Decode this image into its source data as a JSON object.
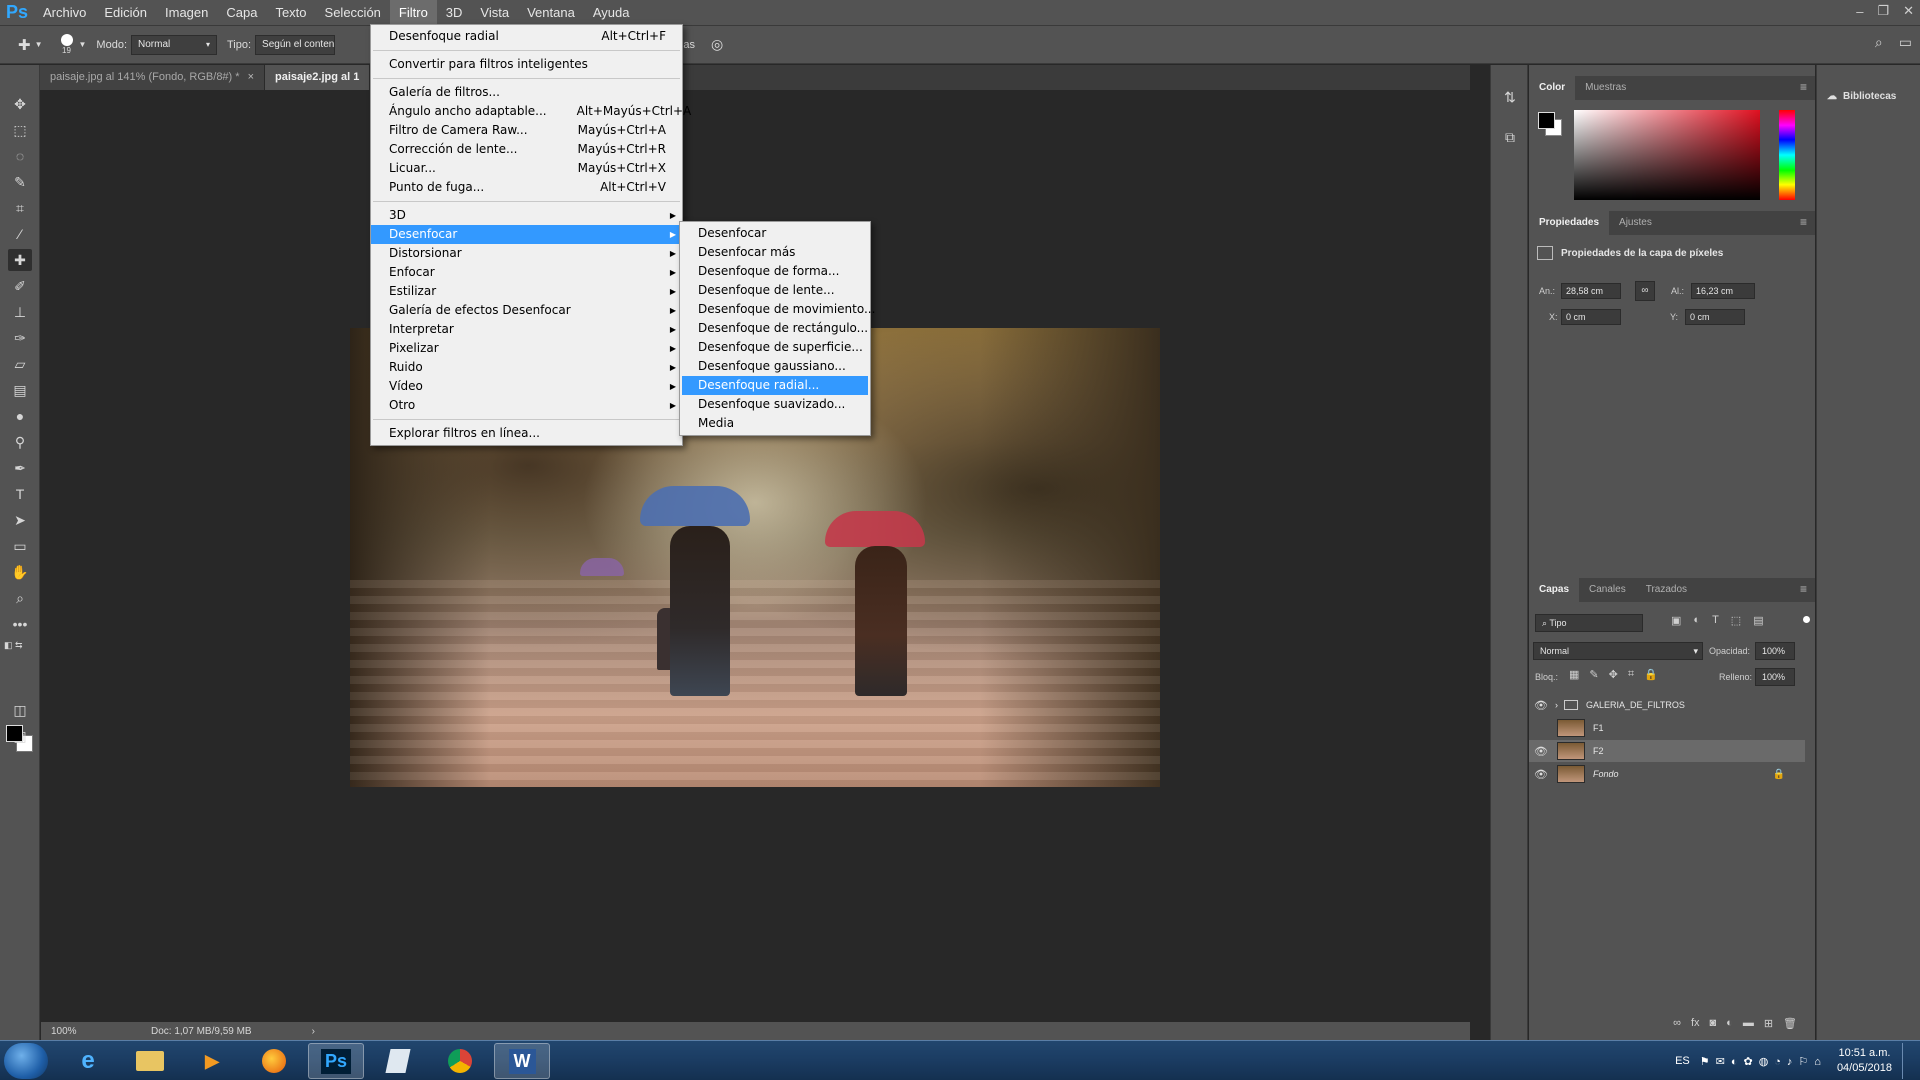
{
  "app": {
    "logo": "Ps"
  },
  "menubar": {
    "items": [
      "Archivo",
      "Edición",
      "Imagen",
      "Capa",
      "Texto",
      "Selección",
      "Filtro",
      "3D",
      "Vista",
      "Ventana",
      "Ayuda"
    ],
    "active": "Filtro"
  },
  "options": {
    "brush_size": "19",
    "mode_label": "Modo:",
    "mode_value": "Normal",
    "type_label": "Tipo:",
    "type_value": "Según el conten",
    "layers_text": "s capas"
  },
  "tabs": [
    {
      "label": "paisaje.jpg al 141% (Fondo, RGB/8#) *",
      "active": false
    },
    {
      "label": "paisaje2.jpg al 1",
      "active": true
    }
  ],
  "filter_menu": {
    "last": {
      "label": "Desenfoque radial",
      "shortcut": "Alt+Ctrl+F"
    },
    "smart": "Convertir para filtros inteligentes",
    "group1": [
      {
        "label": "Galería de filtros...",
        "shortcut": ""
      },
      {
        "label": "Ángulo ancho adaptable...",
        "shortcut": "Alt+Mayús+Ctrl+A"
      },
      {
        "label": "Filtro de Camera Raw...",
        "shortcut": "Mayús+Ctrl+A"
      },
      {
        "label": "Corrección de lente...",
        "shortcut": "Mayús+Ctrl+R"
      },
      {
        "label": "Licuar...",
        "shortcut": "Mayús+Ctrl+X"
      },
      {
        "label": "Punto de fuga...",
        "shortcut": "Alt+Ctrl+V"
      }
    ],
    "submenus": [
      "3D",
      "Desenfocar",
      "Distorsionar",
      "Enfocar",
      "Estilizar",
      "Galería de efectos Desenfocar",
      "Interpretar",
      "Pixelizar",
      "Ruido",
      "Vídeo",
      "Otro"
    ],
    "highlighted": "Desenfocar",
    "browse": "Explorar filtros en línea..."
  },
  "blur_menu": {
    "items": [
      "Desenfocar",
      "Desenfocar más",
      "Desenfoque de forma...",
      "Desenfoque de lente...",
      "Desenfoque de movimiento...",
      "Desenfoque de rectángulo...",
      "Desenfoque de superficie...",
      "Desenfoque gaussiano...",
      "Desenfoque radial...",
      "Desenfoque suavizado...",
      "Media"
    ],
    "highlighted": "Desenfoque radial..."
  },
  "status": {
    "zoom": "100%",
    "doc": "Doc: 1,07 MB/9,59 MB"
  },
  "color_panel": {
    "tabs": [
      "Color",
      "Muestras"
    ],
    "fg": "#000000",
    "bg": "#ffffff",
    "hue": "#e01020"
  },
  "properties": {
    "tabs": [
      "Propiedades",
      "Ajustes"
    ],
    "title": "Propiedades de la capa de píxeles",
    "w_label": "An.:",
    "w_value": "28,58 cm",
    "h_label": "Al.:",
    "h_value": "16,23 cm",
    "x_label": "X:",
    "x_value": "0 cm",
    "y_label": "Y:",
    "y_value": "0 cm"
  },
  "libraries": {
    "label": "Bibliotecas"
  },
  "layers": {
    "tabs": [
      "Capas",
      "Canales",
      "Trazados"
    ],
    "filter_kind": "Tipo",
    "blend_mode": "Normal",
    "opacity_label": "Opacidad:",
    "opacity": "100%",
    "lock_label": "Bloq.:",
    "fill_label": "Relleno:",
    "fill": "100%",
    "rows": [
      {
        "name": "GALERIA_DE_FILTROS",
        "visible": true,
        "type": "group"
      },
      {
        "name": "F1",
        "visible": false,
        "type": "layer"
      },
      {
        "name": "F2",
        "visible": true,
        "type": "layer",
        "selected": true
      },
      {
        "name": "Fondo",
        "visible": true,
        "type": "background"
      }
    ]
  },
  "taskbar": {
    "lang": "ES",
    "time": "10:51 a.m.",
    "date": "04/05/2018",
    "ps_label": "Ps",
    "word_label": "W"
  }
}
